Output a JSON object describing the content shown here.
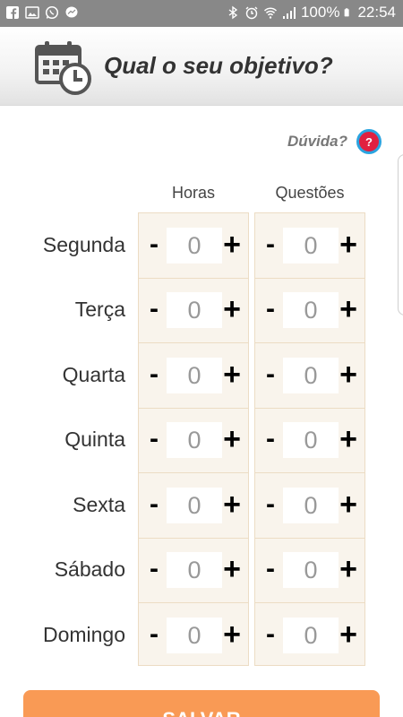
{
  "status_bar": {
    "left_icons": [
      "facebook-icon",
      "gallery-icon",
      "whatsapp-icon",
      "messenger-icon"
    ],
    "right_icons": [
      "bluetooth-icon",
      "alarm-icon",
      "wifi-icon",
      "signal-icon",
      "battery-icon"
    ],
    "battery": "100%",
    "time": "22:54"
  },
  "header": {
    "title": "Qual o seu objetivo?",
    "icon": "calendar-clock-icon"
  },
  "help": {
    "label": "Dúvida?",
    "button": "?"
  },
  "columns": {
    "horas": "Horas",
    "questoes": "Questões"
  },
  "controls": {
    "minus": "-",
    "plus": "+"
  },
  "days": [
    {
      "label": "Segunda",
      "horas": "0",
      "questoes": "0"
    },
    {
      "label": "Terça",
      "horas": "0",
      "questoes": "0"
    },
    {
      "label": "Quarta",
      "horas": "0",
      "questoes": "0"
    },
    {
      "label": "Quinta",
      "horas": "0",
      "questoes": "0"
    },
    {
      "label": "Sexta",
      "horas": "0",
      "questoes": "0"
    },
    {
      "label": "Sábado",
      "horas": "0",
      "questoes": "0"
    },
    {
      "label": "Domingo",
      "horas": "0",
      "questoes": "0"
    }
  ],
  "save_button": "SALVAR",
  "colors": {
    "accent": "#f99a55",
    "column_bg": "#f9f4ec",
    "help_red": "#e02040",
    "help_blue": "#2aa4e0",
    "status_bar": "#888888"
  }
}
